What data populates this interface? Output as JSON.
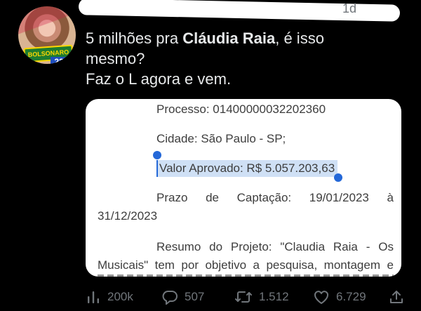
{
  "tweet": {
    "timestamp": "1d",
    "text_line1_prefix": "5 milhões pra ",
    "text_line1_bold": "Cláudia Raia",
    "text_line1_suffix": ", é isso",
    "text_line2": "mesmo?",
    "text_line3": "Faz o L agora e vem."
  },
  "avatar": {
    "badge_text": "BOLSONARO",
    "number": "22"
  },
  "media": {
    "processo": "Processo: 01400000032202360",
    "cidade": "Cidade: São Paulo - SP;",
    "valor_aprovado": "Valor Aprovado: R$ 5.057.203,63",
    "prazo_words": [
      "Prazo",
      "de",
      "Captação:",
      "19/01/2023",
      "à"
    ],
    "prazo_cont": "31/12/2023",
    "resumo_words": [
      "Resumo",
      "do",
      "Projeto:",
      "\"Claudia",
      "Raia",
      "-",
      "Os"
    ],
    "resumo_line2_words": [
      "Musicais\"",
      "tem",
      "por",
      "objetivo",
      "a",
      "pesquisa,",
      "montagem",
      "e"
    ]
  },
  "actions": {
    "views": "200k",
    "replies": "507",
    "retweets": "1.512",
    "likes": "6.729"
  },
  "icons": {
    "views": "bar-chart-icon",
    "replies": "speech-bubble-icon",
    "retweets": "retweet-icon",
    "likes": "heart-icon",
    "share": "share-icon"
  },
  "colors": {
    "background": "#000000",
    "text": "#e7e9ea",
    "muted": "#71767b",
    "selection": "#cfe0f5",
    "selection_handle": "#2468d8"
  }
}
